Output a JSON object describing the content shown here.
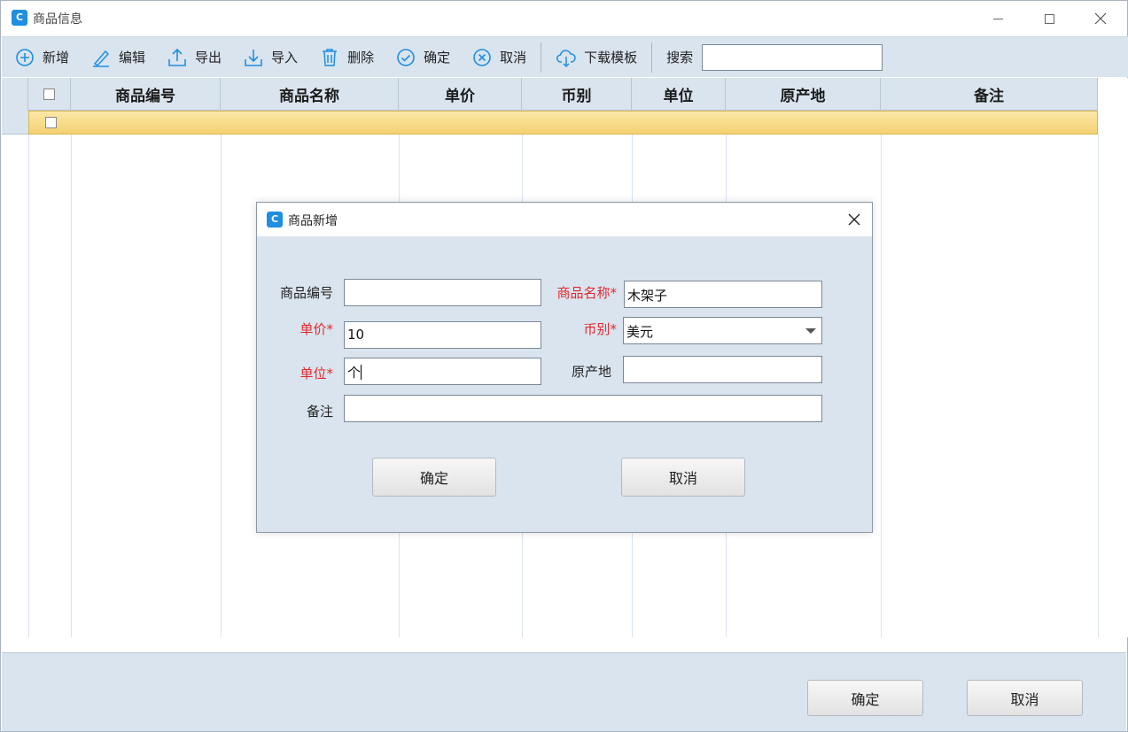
{
  "window": {
    "title": "商品信息",
    "icon": "app-logo-icon"
  },
  "toolbar": {
    "buttons": [
      {
        "label": "新增",
        "icon": "add-circle-icon"
      },
      {
        "label": "编辑",
        "icon": "pencil-icon"
      },
      {
        "label": "导出",
        "icon": "upload-icon"
      },
      {
        "label": "导入",
        "icon": "download-icon"
      },
      {
        "label": "删除",
        "icon": "trash-icon"
      },
      {
        "label": "确定",
        "icon": "check-circle-icon"
      },
      {
        "label": "取消",
        "icon": "close-circle-icon"
      },
      {
        "label": "下载模板",
        "icon": "cloud-download-icon"
      }
    ],
    "search_label": "搜索",
    "search_value": ""
  },
  "grid": {
    "columns": [
      "商品编号",
      "商品名称",
      "单价",
      "币别",
      "单位",
      "原产地",
      "备注"
    ],
    "rows": [
      {
        "checked": false,
        "cells": [
          "",
          "",
          "",
          "",
          "",
          "",
          ""
        ]
      }
    ]
  },
  "bottom": {
    "ok_label": "确定",
    "cancel_label": "取消"
  },
  "dialog": {
    "title": "商品新增",
    "fields": {
      "code": {
        "label": "商品编号",
        "value": ""
      },
      "name": {
        "label": "商品名称*",
        "value": "木架子"
      },
      "price": {
        "label": "单价*",
        "value": "10"
      },
      "currency": {
        "label": "币别*",
        "value": "美元"
      },
      "unit": {
        "label": "单位*",
        "value": "个"
      },
      "origin": {
        "label": "原产地",
        "value": ""
      },
      "remark": {
        "label": "备注",
        "value": ""
      }
    },
    "ok_label": "确定",
    "cancel_label": "取消"
  },
  "colors": {
    "panel": "#dae4ee",
    "accent": "#1e8fe1",
    "required": "#e0292f",
    "selected_row": "#f4d172"
  }
}
